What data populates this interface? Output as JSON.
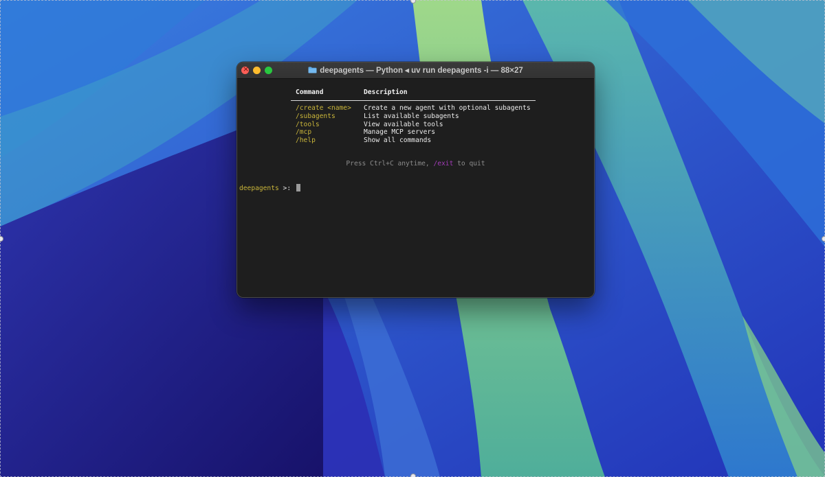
{
  "window": {
    "title": "deepagents — Python ◂ uv run deepagents -i — 88×27"
  },
  "icons": {
    "folder": "folder-icon",
    "close": "close-icon"
  },
  "terminal": {
    "table": {
      "headers": {
        "command": "Command",
        "description": "Description"
      },
      "rows": [
        {
          "command": "/create <name>",
          "description": "Create a new agent with optional subagents"
        },
        {
          "command": "/subagents",
          "description": "List available subagents"
        },
        {
          "command": "/tools",
          "description": "View available tools"
        },
        {
          "command": "/mcp",
          "description": "Manage MCP servers"
        },
        {
          "command": "/help",
          "description": "Show all commands"
        }
      ]
    },
    "hint": {
      "before": "Press Ctrl+C anytime, ",
      "exit": "/exit",
      "after": " to quit"
    },
    "prompt": {
      "name": "deepagents",
      "arrow": " >: "
    }
  },
  "colors": {
    "command_yellow": "#c9b53a",
    "exit_purple": "#a23cb8",
    "terminal_bg": "#1e1e1e",
    "close": "#ff5f57",
    "minimize": "#febc2e",
    "zoom": "#28c840"
  }
}
